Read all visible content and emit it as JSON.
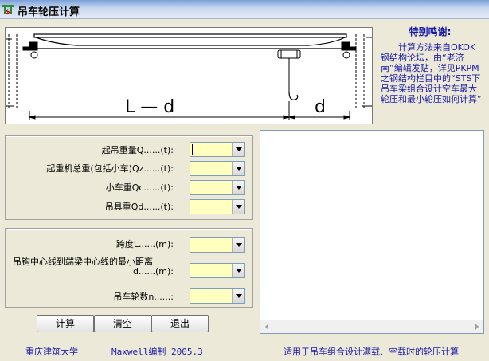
{
  "window": {
    "title": "吊车轮压计算",
    "icon_name": "app-icon"
  },
  "diagram": {
    "label_span": "L — d",
    "label_d": "d"
  },
  "thanks": {
    "title": "特别鸣谢:",
    "body": "计算方法来自OKOK钢结构论坛，由“老济南”编辑发贴，详见PKPM之钢结构栏目中的“STS下吊车梁组合设计空车最大轮压和最小轮压如何计算”"
  },
  "inputs": {
    "crane_weight": {
      "label": "起吊重量Q......(t):",
      "value": ""
    },
    "total_weight": {
      "label": "起重机总重(包括小车)Qz......(t):",
      "value": ""
    },
    "trolley_weight": {
      "label": "小车重Qc......(t):",
      "value": ""
    },
    "rigging_weight": {
      "label": "吊具重Qd......(t):",
      "value": ""
    },
    "span": {
      "label": "跨度L......(m):",
      "value": ""
    },
    "min_distance": {
      "label_line1": "吊钩中心线到端梁中心线的最小距离",
      "label_line2": "d......(m):",
      "value": ""
    },
    "wheel_count": {
      "label": "吊车轮数n......:",
      "value": ""
    }
  },
  "buttons": {
    "calc": "计算",
    "clear": "清空",
    "exit": "退出"
  },
  "footer": {
    "left": "重庆建筑大学",
    "middle": "Maxwell编制 2005.3",
    "right": "适用于吊车组合设计满载、空载时的轮压计算"
  },
  "colors": {
    "input_bg": "#ffffc0",
    "credit_text": "#1a1aa8",
    "window_bg": "#ece9d8"
  }
}
